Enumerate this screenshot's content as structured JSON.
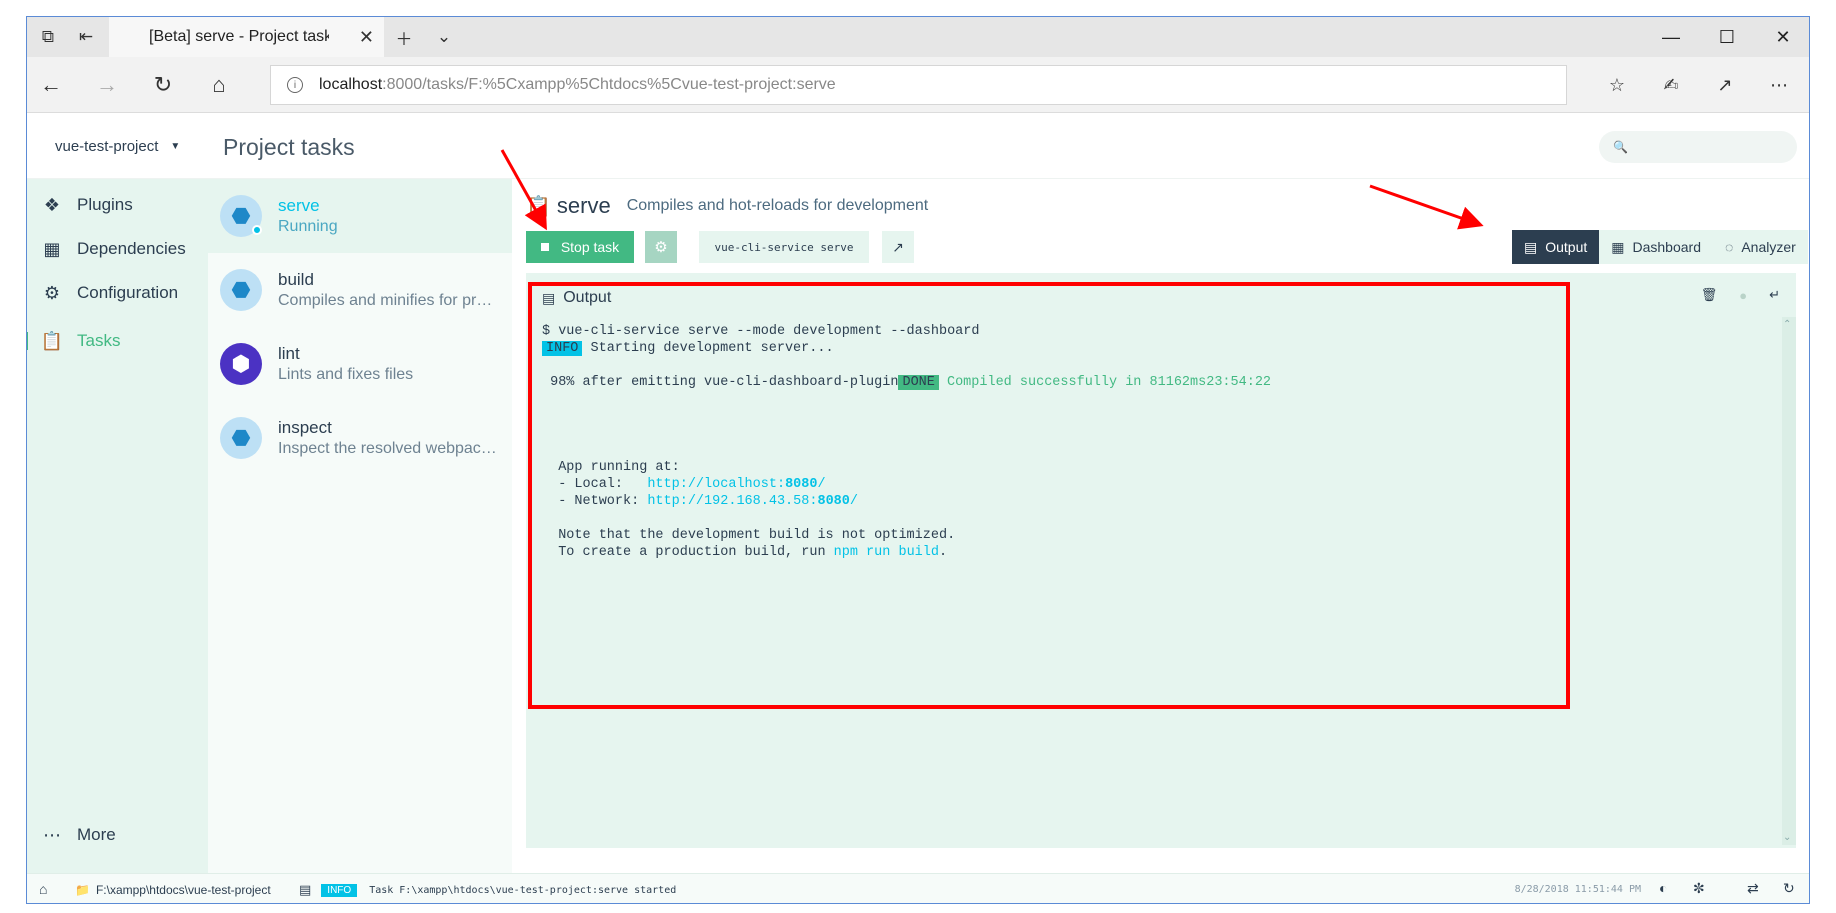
{
  "browser": {
    "tab_title": "[Beta] serve - Project tasks",
    "url_host": "localhost",
    "url_rest": ":8000/tasks/F:%5Cxampp%5Chtdocs%5Cvue-test-project:serve"
  },
  "header": {
    "project": "vue-test-project",
    "page_title": "Project tasks",
    "search_placeholder": ""
  },
  "sidebar": {
    "items": [
      {
        "label": "Plugins",
        "icon": "puzzle-icon"
      },
      {
        "label": "Dependencies",
        "icon": "dependencies-icon"
      },
      {
        "label": "Configuration",
        "icon": "settings-icon"
      },
      {
        "label": "Tasks",
        "icon": "clipboard-icon"
      }
    ],
    "more": "More"
  },
  "tasks": [
    {
      "name": "serve",
      "desc": "Running"
    },
    {
      "name": "build",
      "desc": "Compiles and minifies for production"
    },
    {
      "name": "lint",
      "desc": "Lints and fixes files"
    },
    {
      "name": "inspect",
      "desc": "Inspect the resolved webpack config"
    }
  ],
  "task_detail": {
    "name": "serve",
    "description": "Compiles and hot-reloads for development",
    "stop_label": "Stop task",
    "command": "vue-cli-service serve"
  },
  "view_tabs": [
    "Output",
    "Dashboard",
    "Analyzer"
  ],
  "output": {
    "title": "Output",
    "lines": {
      "cmd": "$ vue-cli-service serve --mode development --dashboard",
      "info_badge": "INFO",
      "info_text": " Starting development server...",
      "progress": " 98% after emitting vue-cli-dashboard-plugin",
      "done_badge": "DONE",
      "done_text": " Compiled successfully in 81162ms23:54:22",
      "app_running": "  App running at:",
      "local_label": "  - Local:   ",
      "local_url_a": "http://localhost:",
      "local_url_port": "8080",
      "local_url_b": "/",
      "network_label": "  - Network: ",
      "network_url_a": "http://192.168.43.58:",
      "network_url_port": "8080",
      "network_url_b": "/",
      "note": "  Note that the development build is not optimized.",
      "create_a": "  To create a production build, run ",
      "create_cmd": "npm run build",
      "create_b": "."
    }
  },
  "statusbar": {
    "path": "F:\\xampp\\htdocs\\vue-test-project",
    "badge": "INFO",
    "message": "Task F:\\xampp\\htdocs\\vue-test-project:serve started",
    "time": "8/28/2018 11:51:44 PM"
  }
}
